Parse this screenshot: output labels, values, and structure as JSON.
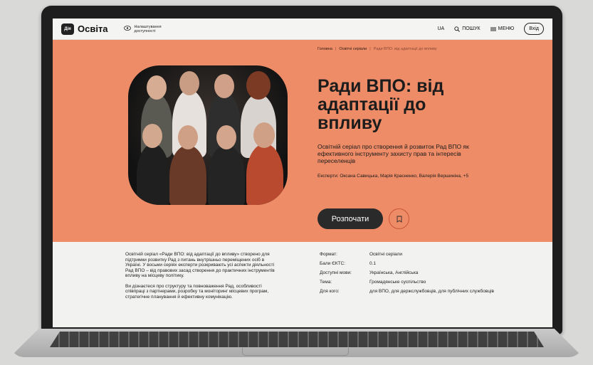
{
  "header": {
    "logo_badge": "Дія",
    "logo_text": "Освіта",
    "accessibility_label": "Налаштування доступності",
    "lang": "UA",
    "search_label": "ПОШУК",
    "menu_label": "МЕНЮ",
    "login_label": "Вхід"
  },
  "breadcrumbs": [
    "Головна",
    "Освітні серіали",
    "Ради ВПО: від адаптації до впливу"
  ],
  "breadcrumb_sep": "|",
  "hero": {
    "title": "Ради ВПО: від адаптації до впливу",
    "subtitle": "Освітній серіал про створення й розвиток Рад ВПО як ефективного інструменту захисту прав та інтересів переселенців",
    "experts": "Експерти: Оксана Савицька, Марія Красненко, Валерія Вершиніна, +5",
    "start_label": "Розпочати"
  },
  "description": [
    "Освітній серіал «Ради ВПО: від адаптації до впливу» створено для підтримки розвитку Рад з питань внутрішньо переміщених осіб в Україні. У восьми серіях експерти розкривають усі аспекти діяльності Рад ВПО – від правових засад створення до практичних інструментів впливу на місцеву політику.",
    "Ви дізнаєтеся про структуру та повноваження Рад, особливості співпраці з партнерами, розробку та моніторинг місцевих програм, стратегічне планування й ефективну комунікацію."
  ],
  "meta": [
    {
      "key": "Формат:",
      "value": "Освітні серіали"
    },
    {
      "key": "Бали ЄКТС:",
      "value": "0.1"
    },
    {
      "key": "Доступні мови:",
      "value": "Українська, Англійська"
    },
    {
      "key": "Тема:",
      "value": "Громадянське суспільство"
    },
    {
      "key": "Для кого:",
      "value": "для ВПО, для держслужбовців, для публічних службовців"
    }
  ],
  "colors": {
    "hero_bg": "#ee8c67",
    "dark": "#2a2a2a",
    "page_bg": "#f2f2f0"
  },
  "icons": [
    "eye-icon",
    "search-icon",
    "menu-icon",
    "bookmark-icon"
  ]
}
